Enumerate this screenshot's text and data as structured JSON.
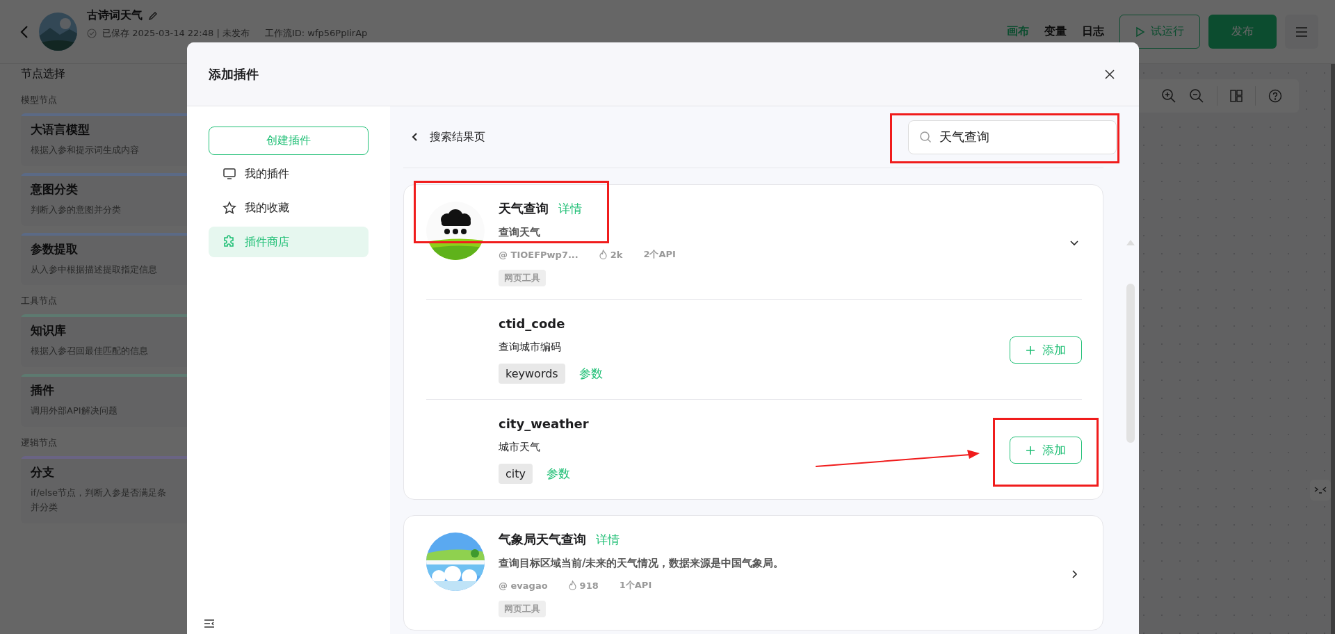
{
  "app_header": {
    "title": "古诗词天气",
    "status": "已保存 2025-03-14 22:48 | 未发布",
    "workflow_id": "工作流ID: wfp56PpIirAp",
    "tabs": [
      {
        "label": "画布",
        "selected": true
      },
      {
        "label": "变量",
        "selected": false
      },
      {
        "label": "日志",
        "selected": false
      }
    ],
    "run_button": "试运行",
    "publish_button": "发布"
  },
  "node_panel": {
    "title": "节点选择",
    "groups": [
      {
        "name": "模型节点",
        "nodes": [
          {
            "title": "大语言模型",
            "description": "根据入参和提示词生成内容",
            "color": "#5b6a86"
          },
          {
            "title": "意图分类",
            "description": "判断入参的意图并分类",
            "color": "#5b6a86"
          },
          {
            "title": "参数提取",
            "description": "从入参中根据描述提取指定信息",
            "color": "#5b6a86"
          }
        ]
      },
      {
        "name": "工具节点",
        "nodes": [
          {
            "title": "知识库",
            "description": "根据入参召回最佳匹配的信息",
            "color": "#5d7a70"
          },
          {
            "title": "插件",
            "description": "调用外部API解决问题",
            "color": "#5d7a70"
          }
        ]
      },
      {
        "name": "逻辑节点",
        "nodes": [
          {
            "title": "分支",
            "description": "if/else节点，判断入参是否满足条",
            "description_continued": "并分类",
            "color": "#6a6484"
          }
        ]
      }
    ]
  },
  "dialog": {
    "title": "添加插件",
    "create_button": "创建插件",
    "nav": [
      {
        "kind": "monitor",
        "label": "我的插件",
        "selected": false
      },
      {
        "kind": "star",
        "label": "我的收藏",
        "selected": false
      },
      {
        "kind": "puzzle",
        "label": "插件商店",
        "selected": true
      }
    ],
    "back_label": "搜索结果页",
    "search": {
      "value": "天气查询",
      "highlighted": true
    },
    "plugins": [
      {
        "name": "天气查询",
        "detail_link": "详情",
        "description": "查询天气",
        "author": "@ TIOEFPwp7...",
        "likes": "2k",
        "api_count": "2个API",
        "tags": [
          "网页工具"
        ],
        "expanded": true,
        "highlighted": true,
        "tools": [
          {
            "name": "ctid_code",
            "description": "查询城市编码",
            "params": [
              "keywords"
            ],
            "params_link": "参数",
            "add_button": "添加",
            "highlighted": false,
            "pointed_at": false
          },
          {
            "name": "city_weather",
            "description": "城市天气",
            "params": [
              "city"
            ],
            "params_link": "参数",
            "add_button": "添加",
            "highlighted": true,
            "pointed_at": true
          }
        ]
      },
      {
        "name": "气象局天气查询",
        "detail_link": "详情",
        "description": "查询目标区域当前/未来的天气情况，数据来源是中国气象局。",
        "author": "@ evagao",
        "likes": "918",
        "api_count": "1个API",
        "tags": [
          "网页工具"
        ],
        "expanded": false,
        "highlighted": false
      }
    ]
  }
}
